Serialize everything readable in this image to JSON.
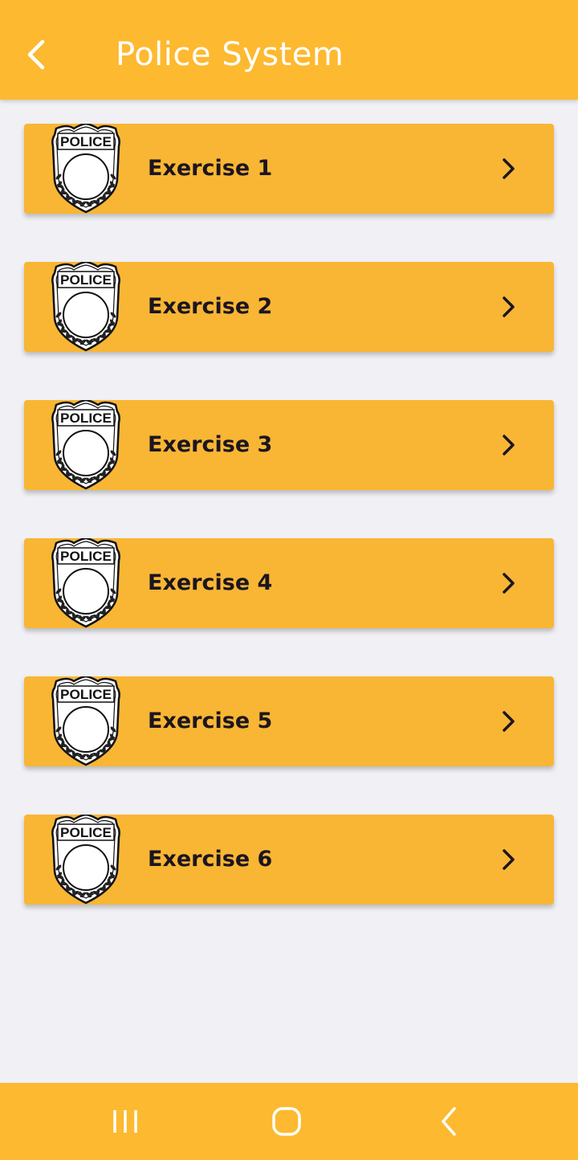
{
  "header": {
    "title": "Police System",
    "back_icon": "chevron-left-icon"
  },
  "badge": {
    "text": "POLICE",
    "icon": "police-badge-icon"
  },
  "exercises": [
    {
      "label": "Exercise 1"
    },
    {
      "label": "Exercise 2"
    },
    {
      "label": "Exercise 3"
    },
    {
      "label": "Exercise 4"
    },
    {
      "label": "Exercise 5"
    },
    {
      "label": "Exercise 6"
    }
  ],
  "navbar": {
    "recent_icon": "recent-apps-icon",
    "home_icon": "home-icon",
    "back_icon": "back-icon"
  },
  "colors": {
    "app_bar": "#fdb930",
    "card": "#f8b634",
    "background": "#f1f0f4",
    "label_text": "#1c1520"
  }
}
